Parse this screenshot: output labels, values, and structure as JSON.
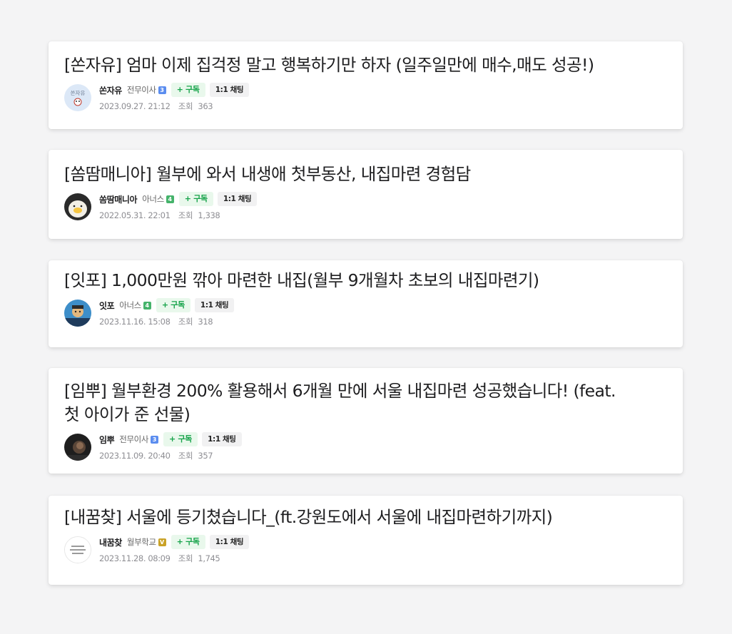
{
  "posts": [
    {
      "title": "[쏜자유] 엄마 이제 집걱정 말고 행복하기만 하자 (일주일만에 매수,매도 성공!)",
      "nickname": "쏜자유",
      "grade": "전무이사",
      "grade_badge": "3",
      "grade_badge_color": "#5b8def",
      "subscribe_label": "+ 구독",
      "chat_label": "1:1 채팅",
      "date": "2023.09.27. 21:12",
      "views_label": "조회",
      "views": "363",
      "avatar_text": "쏜자유",
      "avatar_icon": "avatar-illustration-icon"
    },
    {
      "title": "[쏨땀매니아] 월부에 와서 내생애 첫부동산, 내집마련 경험담",
      "nickname": "쏨땀매니아",
      "grade": "아너스",
      "grade_badge": "4",
      "grade_badge_color": "#45b36b",
      "subscribe_label": "+ 구독",
      "chat_label": "1:1 채팅",
      "date": "2022.05.31. 22:01",
      "views_label": "조회",
      "views": "1,338",
      "avatar_icon": "egg-character-icon"
    },
    {
      "title": "[잇포] 1,000만원 깎아 마련한 내집(월부 9개월차 초보의 내집마련기)",
      "nickname": "잇포",
      "grade": "아너스",
      "grade_badge": "4",
      "grade_badge_color": "#45b36b",
      "subscribe_label": "+ 구독",
      "chat_label": "1:1 채팅",
      "date": "2023.11.16. 15:08",
      "views_label": "조회",
      "views": "318",
      "avatar_icon": "character-illustration-icon"
    },
    {
      "title": "[임뿌] 월부환경 200% 활용해서 6개월 만에 서울 내집마련 성공했습니다! (feat. 첫 아이가 준 선물)",
      "nickname": "임뿌",
      "grade": "전무이사",
      "grade_badge": "3",
      "grade_badge_color": "#5b8def",
      "subscribe_label": "+ 구독",
      "chat_label": "1:1 채팅",
      "date": "2023.11.09. 20:40",
      "views_label": "조회",
      "views": "357",
      "avatar_icon": "photo-avatar-icon"
    },
    {
      "title": "[내꿈찾] 서울에 등기쳤습니다_(ft.강원도에서 서울에 내집마련하기까지)",
      "nickname": "내꿈찾",
      "grade": "월부학교",
      "grade_badge": "V",
      "grade_badge_color": "#c9a227",
      "subscribe_label": "+ 구독",
      "chat_label": "1:1 채팅",
      "date": "2023.11.28. 08:09",
      "views_label": "조회",
      "views": "1,745",
      "avatar_icon": "text-logo-icon"
    }
  ]
}
